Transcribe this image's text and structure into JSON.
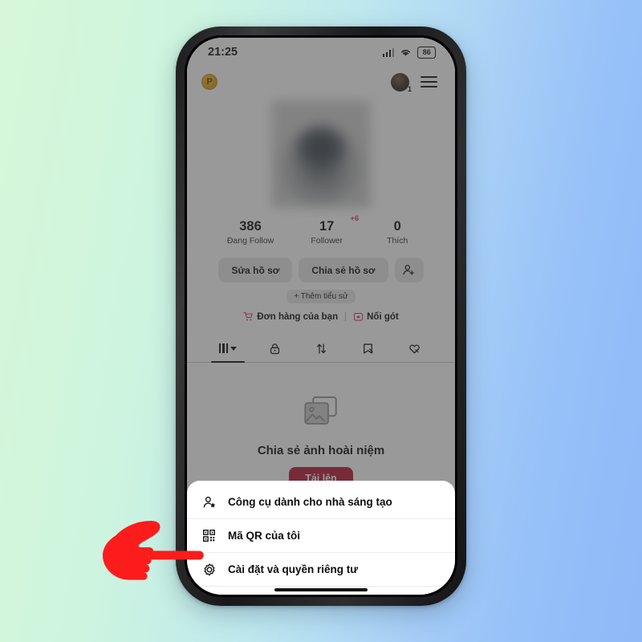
{
  "status_bar": {
    "time": "21:25",
    "signal_icon": "signal-bars-icon",
    "wifi_icon": "wifi-icon",
    "battery_level": "86"
  },
  "header": {
    "pro_badge": "P",
    "avatar_badge": "1",
    "menu_icon": "hamburger-menu-icon"
  },
  "stats": [
    {
      "value": "386",
      "label": "Đang Follow",
      "delta": ""
    },
    {
      "value": "17",
      "label": "Follower",
      "delta": "+6"
    },
    {
      "value": "0",
      "label": "Thích",
      "delta": ""
    }
  ],
  "actions": {
    "edit_profile": "Sửa hồ sơ",
    "share_profile": "Chia sẻ hồ sơ",
    "add_person_icon": "add-person-icon",
    "add_bio": "+ Thêm tiểu sử"
  },
  "links": [
    {
      "label": "Đơn hàng của bạn",
      "icon": "shopping-cart-icon"
    },
    {
      "label": "Nối gót",
      "icon": "footsteps-box-icon"
    }
  ],
  "tabs": [
    {
      "name": "grid",
      "icon": "grid-icon",
      "active": true
    },
    {
      "name": "private",
      "icon": "lock-icon",
      "active": false
    },
    {
      "name": "reposts",
      "icon": "repost-arrows-icon",
      "active": false
    },
    {
      "name": "tagged",
      "icon": "bookmark-tag-icon",
      "active": false
    },
    {
      "name": "liked",
      "icon": "heart-icon",
      "active": false
    }
  ],
  "empty_state": {
    "image_icon": "photo-stack-icon",
    "title": "Chia sẻ ảnh hoài niệm",
    "upload_label": "Tải lên"
  },
  "bottom_sheet": {
    "items": [
      {
        "label": "Công cụ dành cho nhà sáng tạo",
        "icon": "person-star-icon"
      },
      {
        "label": "Mã QR của tôi",
        "icon": "qr-code-icon"
      },
      {
        "label": "Cài đặt và quyền riêng tư",
        "icon": "gear-icon"
      }
    ]
  },
  "cursor": {
    "icon": "pointing-hand-icon",
    "color": "#fc1c1c"
  },
  "colors": {
    "accent_red": "#b81b38",
    "delta_pink": "#e23b5b",
    "pro_gold": "#d48f11",
    "background_left": "#d6f7d9",
    "background_right": "#90baf7"
  }
}
